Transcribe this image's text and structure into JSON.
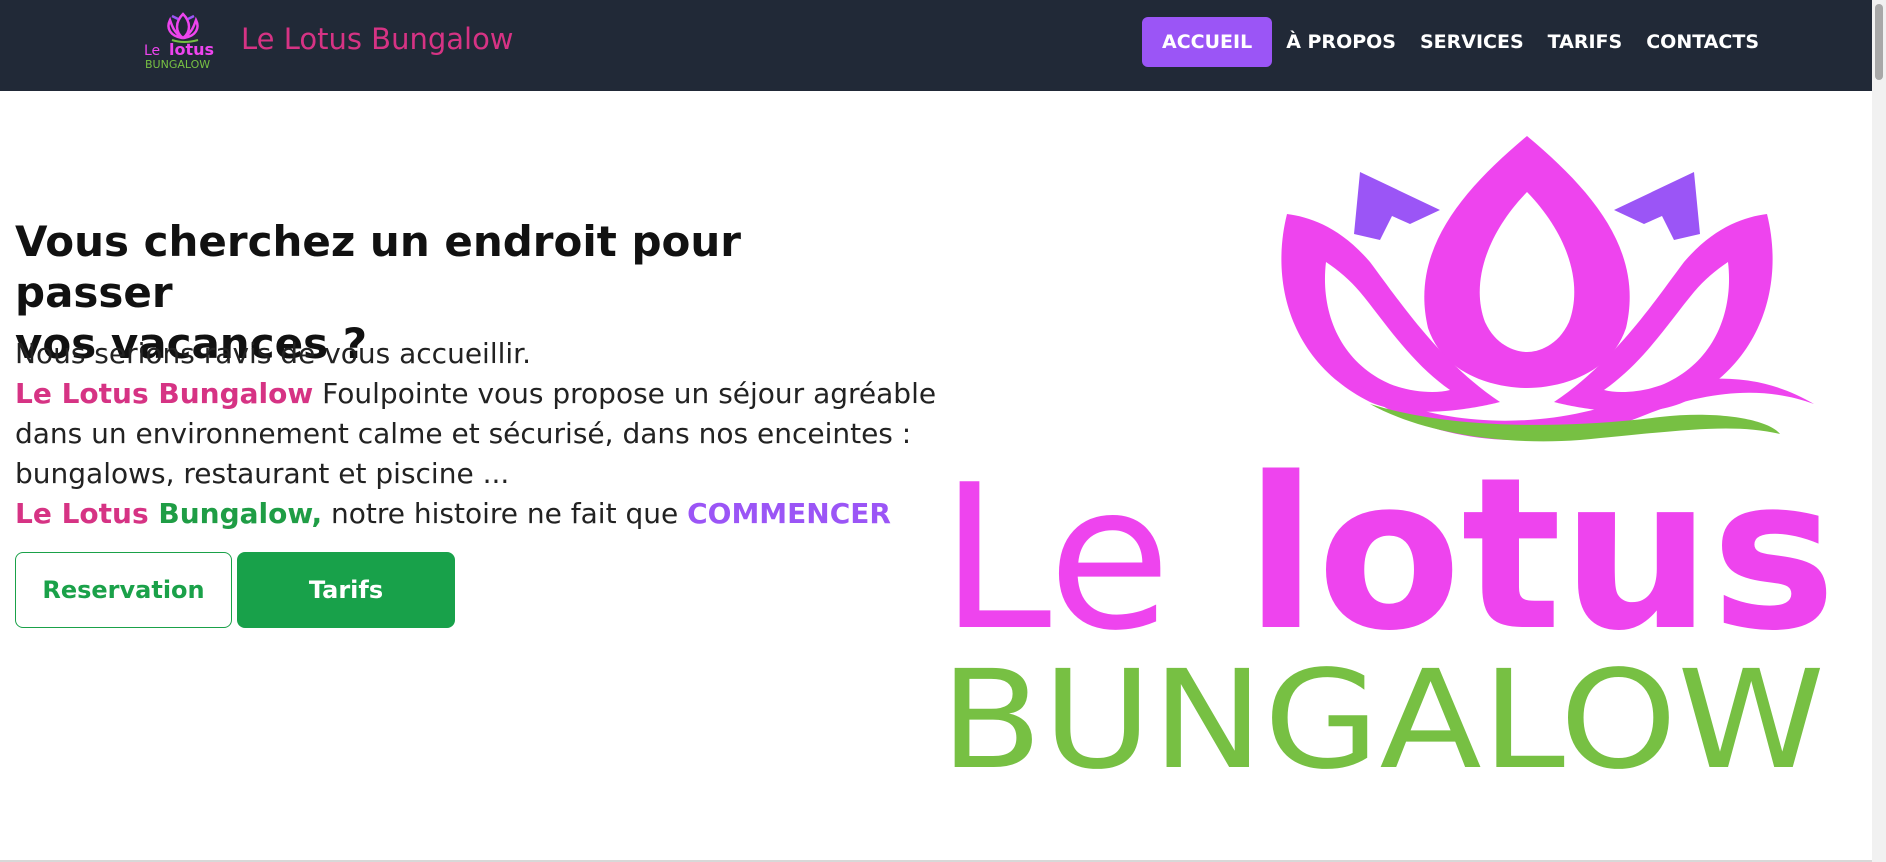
{
  "navbar": {
    "logo_text_le": "Le",
    "logo_text_lotus": "lotus",
    "logo_text_bungalow": "BUNGALOW",
    "brand_name": "Le Lotus Bungalow",
    "items": [
      {
        "label": "ACCUEIL",
        "active": true
      },
      {
        "label": "À PROPOS"
      },
      {
        "label": "SERVICES"
      },
      {
        "label": "TARIFS"
      },
      {
        "label": "CONTACTS"
      }
    ]
  },
  "hero": {
    "title_line1": "Vous cherchez un endroit pour passer",
    "title_line2": "vos vacances ?",
    "line1": "Nous serions ravis de vous accueillir.",
    "line2_brand": "Le Lotus Bungalow",
    "line2_rest": " Foulpointe vous propose un séjour agréable",
    "line3": "dans un environnement calme et sécurisé, dans nos enceintes :",
    "line4": "bungalows, restaurant et piscine ...",
    "line5_le_lotus": "Le Lotus ",
    "line5_bungalow": "Bungalow,",
    "line5_mid": " notre histoire ne fait que ",
    "line5_end": "COMMENCER",
    "btn_reservation": "Reservation",
    "btn_tarifs": "Tarifs"
  },
  "big_logo": {
    "text_le": "Le",
    "text_lotus": "lotus",
    "text_bungalow": "BUNGALOW"
  },
  "colors": {
    "navbar_bg": "#212937",
    "accent_purple": "#9b55f6",
    "brand_pink": "#d63384",
    "logo_magenta": "#ee44ee",
    "logo_green": "#77c043",
    "button_green": "#18a14a"
  }
}
